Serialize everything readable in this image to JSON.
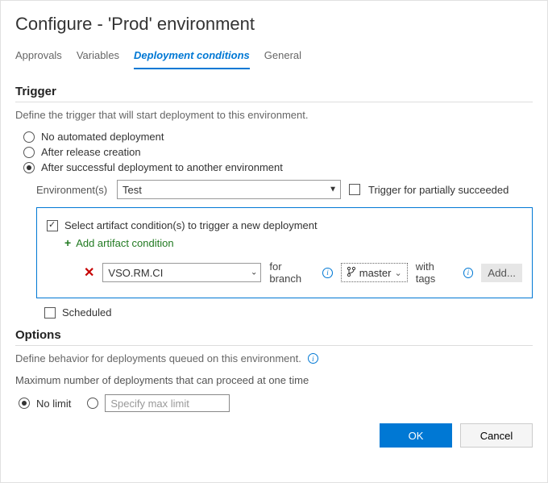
{
  "title": "Configure - 'Prod' environment",
  "tabs": {
    "approvals": "Approvals",
    "variables": "Variables",
    "deployment_conditions": "Deployment conditions",
    "general": "General"
  },
  "trigger": {
    "heading": "Trigger",
    "desc": "Define the trigger that will start deployment to this environment.",
    "opt_no_auto": "No automated deployment",
    "opt_after_release": "After release creation",
    "opt_after_success": "After successful deployment to another environment",
    "environments_label": "Environment(s)",
    "environments_value": "Test",
    "trigger_partial": "Trigger for partially succeeded",
    "select_artifact": "Select artifact condition(s) to trigger a new deployment",
    "add_artifact": "Add artifact condition",
    "condition": {
      "source": "VSO.RM.CI",
      "for_branch": "for branch",
      "branch": "master",
      "with_tags": "with tags",
      "add": "Add..."
    },
    "scheduled": "Scheduled"
  },
  "options": {
    "heading": "Options",
    "desc": "Define behavior for deployments queued on this environment.",
    "max_label": "Maximum number of deployments that can proceed at one time",
    "no_limit": "No limit",
    "specify_placeholder": "Specify max limit"
  },
  "footer": {
    "ok": "OK",
    "cancel": "Cancel"
  }
}
